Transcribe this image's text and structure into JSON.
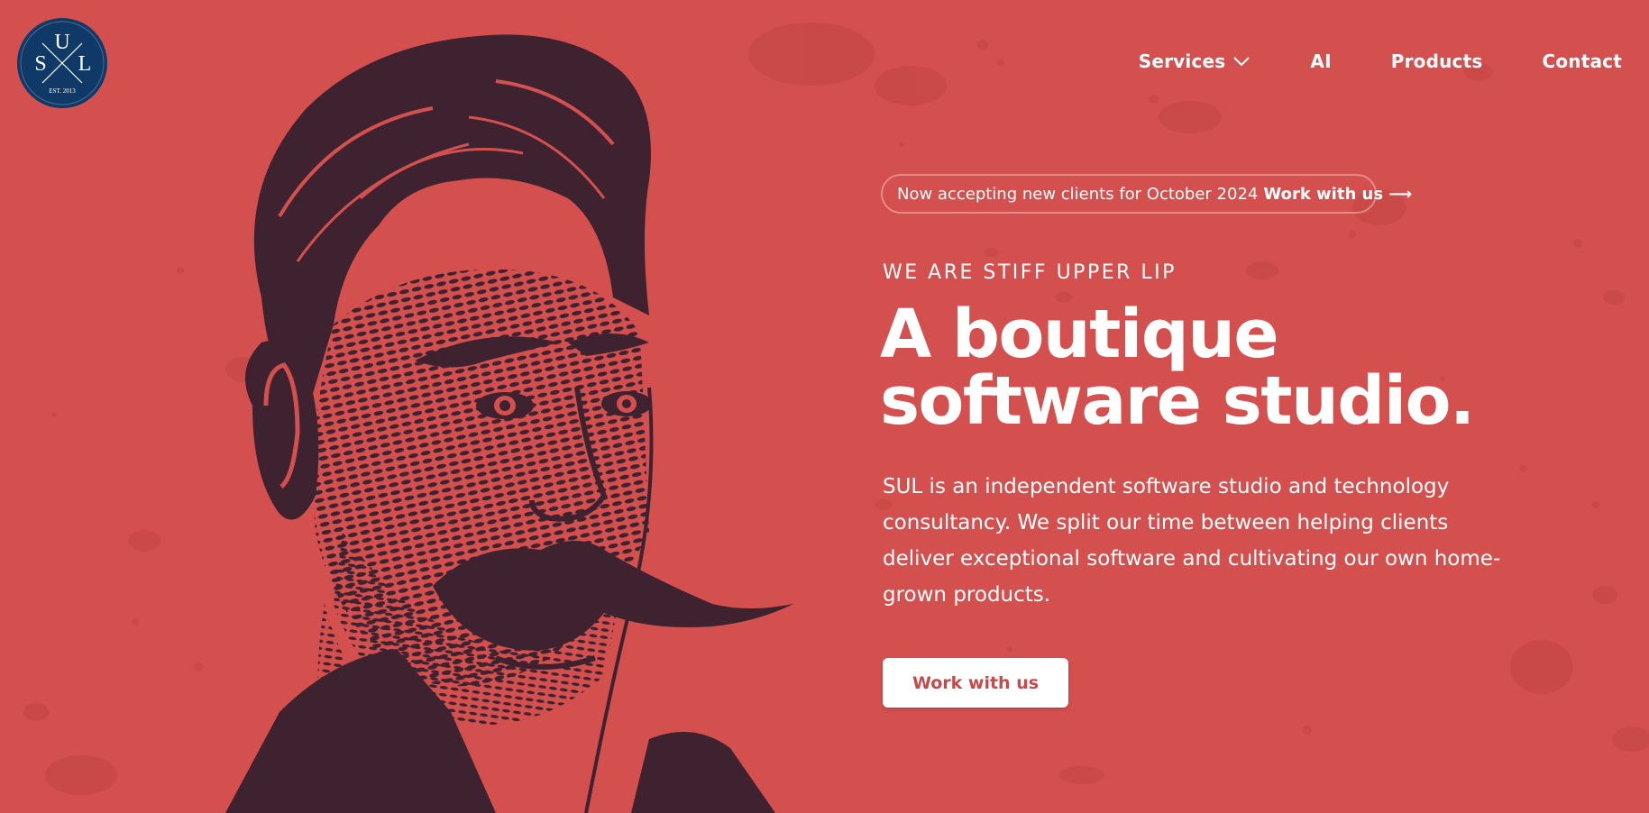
{
  "logo": {
    "letters": [
      "S",
      "U",
      "L"
    ],
    "established": "EST. 2013",
    "background": "#0f3a68"
  },
  "nav": {
    "items": [
      {
        "label": "Services",
        "has_dropdown": true,
        "icon": "chevron-down-icon"
      },
      {
        "label": "AI"
      },
      {
        "label": "Products"
      },
      {
        "label": "Contact"
      }
    ]
  },
  "announcement": {
    "text": "Now accepting new clients for October 2024",
    "link_label": "Work with us",
    "arrow": "⟶"
  },
  "hero": {
    "eyebrow": "WE ARE STIFF UPPER LIP",
    "headline_line1": "A boutique",
    "headline_line2": "software studio.",
    "body": "SUL is an independent software studio and technology consultancy. We split our time between helping clients deliver exceptional software and cultivating our own home-grown products.",
    "cta_label": "Work with us"
  },
  "colors": {
    "background": "#d3504e",
    "illustration": "#3f2230",
    "text": "#ffffff",
    "cta_text": "#c54a4a"
  }
}
